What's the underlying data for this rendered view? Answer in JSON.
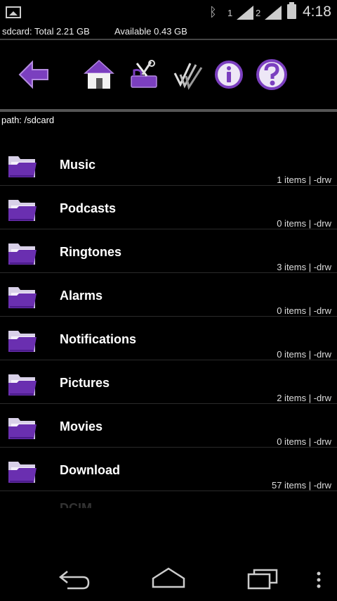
{
  "status_bar": {
    "sim1": "1",
    "sim2": "2",
    "time": "4:18",
    "icons": [
      "image-notification-icon",
      "bluetooth-icon",
      "signal-icon",
      "battery-icon"
    ]
  },
  "storage": {
    "total": "sdcard: Total 2.21 GB",
    "available": "Available 0.43 GB"
  },
  "toolbar": [
    "back-icon",
    "home-icon",
    "tools-icon",
    "multiselect-icon",
    "info-icon",
    "help-icon"
  ],
  "path": "path: /sdcard",
  "files": [
    {
      "name": "Music",
      "meta": "1 items | -drw"
    },
    {
      "name": "Podcasts",
      "meta": "0 items | -drw"
    },
    {
      "name": "Ringtones",
      "meta": "3 items | -drw"
    },
    {
      "name": "Alarms",
      "meta": "0 items | -drw"
    },
    {
      "name": "Notifications",
      "meta": "0 items | -drw"
    },
    {
      "name": "Pictures",
      "meta": "2 items | -drw"
    },
    {
      "name": "Movies",
      "meta": "0 items | -drw"
    },
    {
      "name": "Download",
      "meta": "57 items | -drw"
    }
  ],
  "partial_item": "DCIM",
  "colors": {
    "accent": "#7b3fbf",
    "accent_light": "#b48be0",
    "background": "#000000"
  }
}
